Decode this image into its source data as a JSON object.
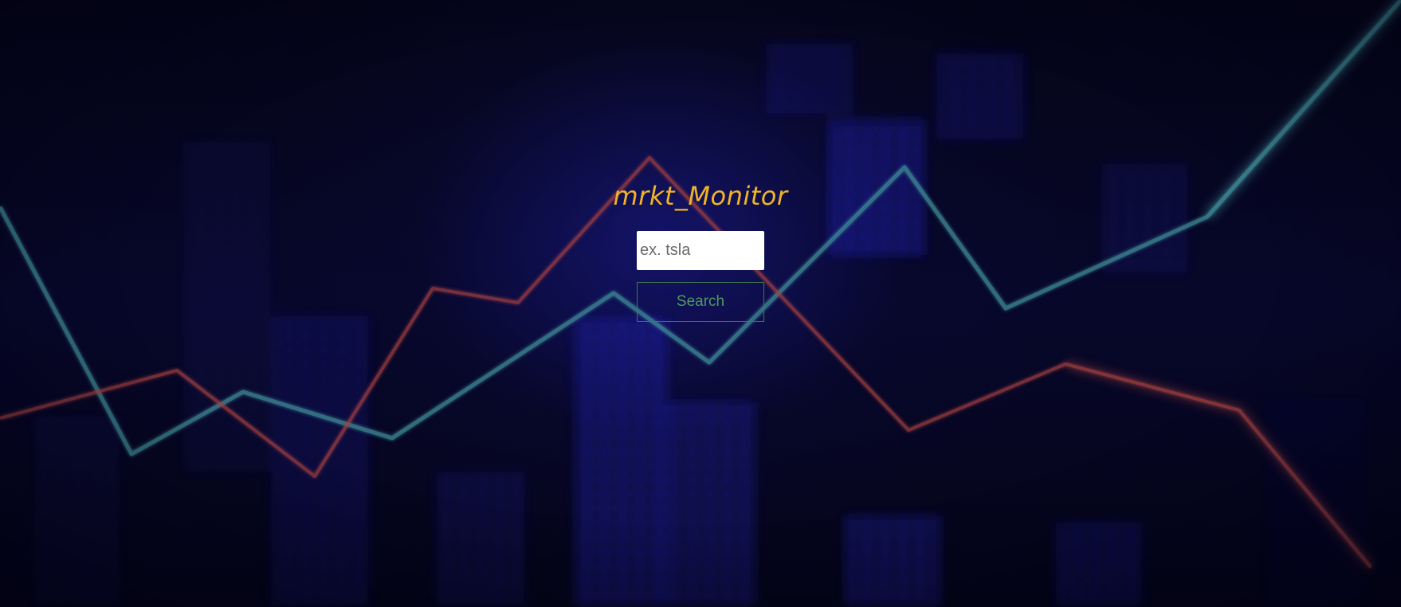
{
  "app": {
    "title": "mrkt_Monitor"
  },
  "search": {
    "placeholder": "ex. tsla",
    "value": "",
    "button_label": "Search"
  },
  "colors": {
    "title": "#f0b429",
    "button_text": "#4f9a5c",
    "button_border": "#3f7a4b",
    "background": "#05051a",
    "line_teal": "#3f8f99",
    "line_red": "#a5403f",
    "bars_blue": "#1c1cc8"
  }
}
